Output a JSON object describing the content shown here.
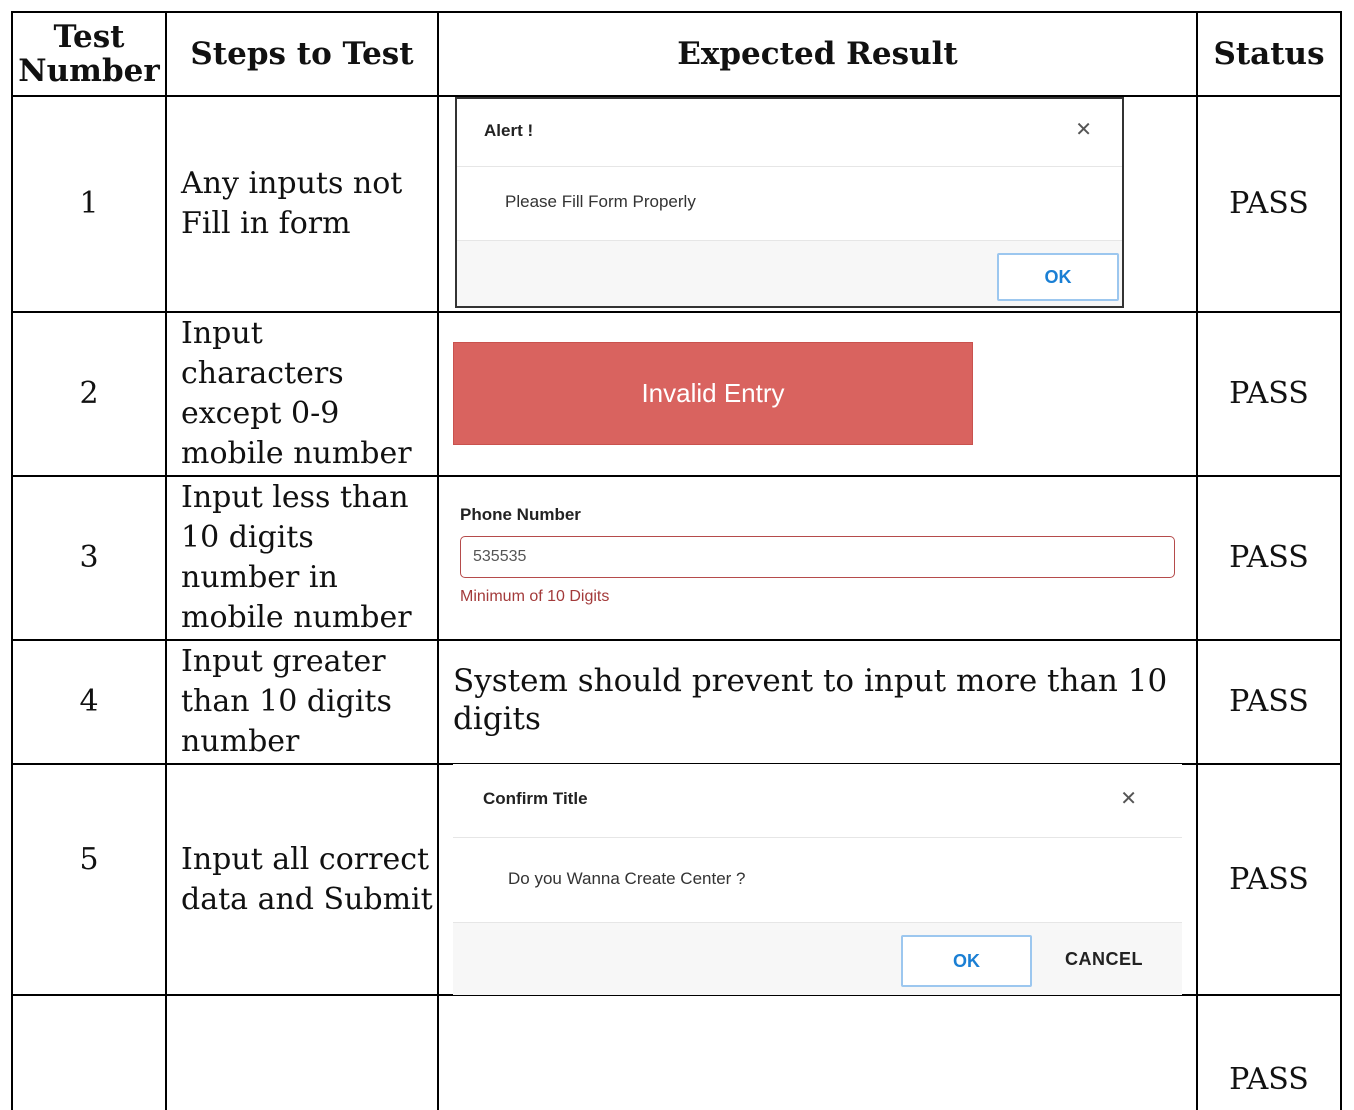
{
  "headers": {
    "test_number": "Test Number",
    "steps": "Steps to Test",
    "expected": "Expected Result",
    "status": "Status"
  },
  "rows": [
    {
      "number": "1",
      "steps": [
        "Any inputs not",
        "Fill in form"
      ],
      "status": "PASS",
      "expected": {
        "dialog_title": "Alert !",
        "close_icon": "close-icon",
        "message": "Please Fill Form Properly",
        "ok_label": "OK"
      }
    },
    {
      "number": "2",
      "steps": [
        "Input",
        "characters",
        "except 0-9",
        "mobile number"
      ],
      "status": "PASS",
      "expected": {
        "banner_text": "Invalid Entry",
        "banner_color": "#d9635f"
      }
    },
    {
      "number": "3",
      "steps": [
        "Input less than",
        "10 digits",
        "number in",
        "mobile number"
      ],
      "status": "PASS",
      "expected": {
        "field_label": "Phone Number",
        "field_value": "535535",
        "error_text": "Minimum of 10 Digits",
        "error_color": "#a33a3a"
      }
    },
    {
      "number": "4",
      "steps": [
        "Input greater",
        "than 10 digits",
        "number"
      ],
      "status": "PASS",
      "expected": {
        "text": "System should prevent to input more than 10 digits"
      }
    },
    {
      "number": "5",
      "steps": [
        "Input all correct",
        "data and Submit"
      ],
      "status": "PASS",
      "expected": {
        "dialog_title": "Confirm Title",
        "close_icon": "close-icon",
        "message": "Do you Wanna Create Center ?",
        "ok_label": "OK",
        "cancel_label": "CANCEL"
      }
    },
    {
      "number": "",
      "steps": [],
      "status": "PASS"
    }
  ]
}
